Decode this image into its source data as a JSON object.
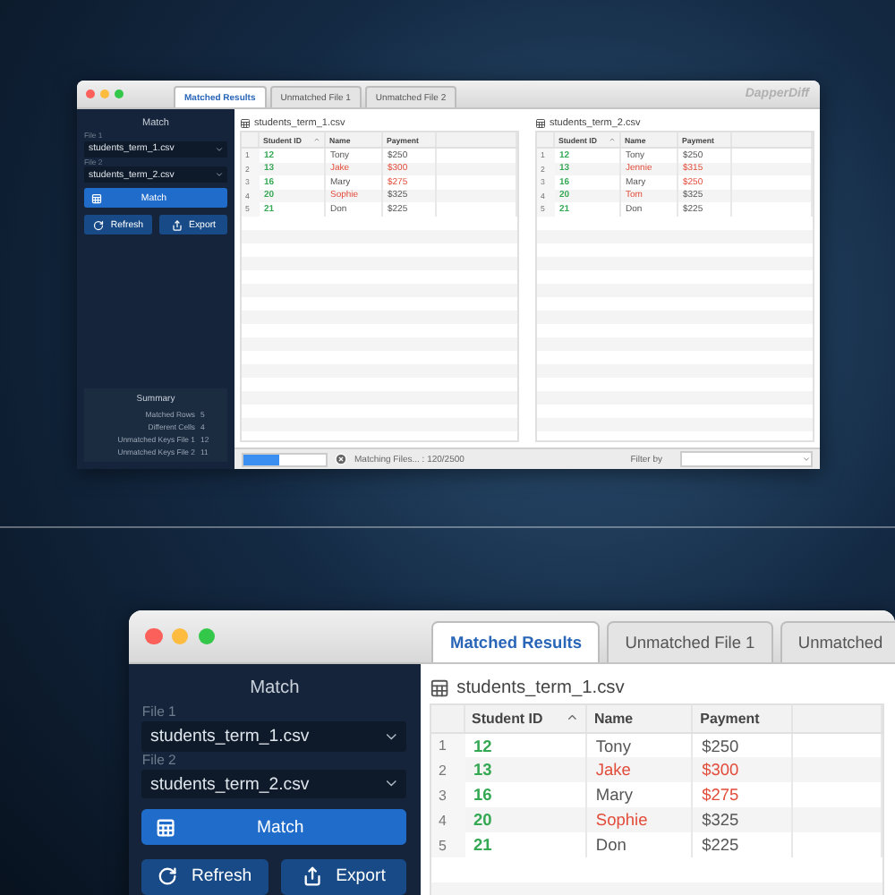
{
  "overview": {
    "window": {
      "app_name": "DapperDiff"
    },
    "tabs": [
      {
        "label": "Matched Results",
        "selected": true
      },
      {
        "label": "Unmatched File 1",
        "selected": false
      },
      {
        "label": "Unmatched File 2",
        "selected": false
      }
    ],
    "sidebar": {
      "title": "Match",
      "files": [
        {
          "label": "File 1",
          "value": "students_term_1.csv"
        },
        {
          "label": "File 2",
          "value": "students_term_2.csv"
        }
      ],
      "buttons": [
        {
          "kind": "match",
          "label": "Match"
        },
        {
          "kind": "refresh",
          "label": "Refresh"
        },
        {
          "kind": "export",
          "label": "Export"
        }
      ],
      "summary": {
        "title": "Summary",
        "rows": [
          {
            "label": "Matched Rows",
            "value": "5"
          },
          {
            "label": "Different Cells",
            "value": "4"
          },
          {
            "label": "Unmatched Keys File 1",
            "value": "12"
          },
          {
            "label": "Unmatched Keys File 2",
            "value": "11"
          }
        ]
      }
    },
    "panes": [
      {
        "file": "students_term_1.csv",
        "columns": [
          {
            "label": "Student ID",
            "sorted": true
          },
          {
            "label": "Name",
            "sorted": false
          },
          {
            "label": "Payment",
            "sorted": false
          }
        ],
        "rows": [
          {
            "number": "1",
            "cells": [
              {
                "text": "12",
                "key": true,
                "differs": false
              },
              {
                "text": "Tony",
                "key": false,
                "differs": false
              },
              {
                "text": "$250",
                "key": false,
                "differs": false
              }
            ]
          },
          {
            "number": "2",
            "cells": [
              {
                "text": "13",
                "key": true,
                "differs": false
              },
              {
                "text": "Jake",
                "key": false,
                "differs": true
              },
              {
                "text": "$300",
                "key": false,
                "differs": true
              }
            ]
          },
          {
            "number": "3",
            "cells": [
              {
                "text": "16",
                "key": true,
                "differs": false
              },
              {
                "text": "Mary",
                "key": false,
                "differs": false
              },
              {
                "text": "$275",
                "key": false,
                "differs": true
              }
            ]
          },
          {
            "number": "4",
            "cells": [
              {
                "text": "20",
                "key": true,
                "differs": false
              },
              {
                "text": "Sophie",
                "key": false,
                "differs": true
              },
              {
                "text": "$325",
                "key": false,
                "differs": false
              }
            ]
          },
          {
            "number": "5",
            "cells": [
              {
                "text": "21",
                "key": true,
                "differs": false
              },
              {
                "text": "Don",
                "key": false,
                "differs": false
              },
              {
                "text": "$225",
                "key": false,
                "differs": false
              }
            ]
          }
        ]
      },
      {
        "file": "students_term_2.csv",
        "columns": [
          {
            "label": "Student ID",
            "sorted": true
          },
          {
            "label": "Name",
            "sorted": false
          },
          {
            "label": "Payment",
            "sorted": false
          }
        ],
        "rows": [
          {
            "number": "1",
            "cells": [
              {
                "text": "12",
                "key": true,
                "differs": false
              },
              {
                "text": "Tony",
                "key": false,
                "differs": false
              },
              {
                "text": "$250",
                "key": false,
                "differs": false
              }
            ]
          },
          {
            "number": "2",
            "cells": [
              {
                "text": "13",
                "key": true,
                "differs": false
              },
              {
                "text": "Jennie",
                "key": false,
                "differs": true
              },
              {
                "text": "$315",
                "key": false,
                "differs": true
              }
            ]
          },
          {
            "number": "3",
            "cells": [
              {
                "text": "16",
                "key": true,
                "differs": false
              },
              {
                "text": "Mary",
                "key": false,
                "differs": false
              },
              {
                "text": "$250",
                "key": false,
                "differs": true
              }
            ]
          },
          {
            "number": "4",
            "cells": [
              {
                "text": "20",
                "key": true,
                "differs": false
              },
              {
                "text": "Tom",
                "key": false,
                "differs": true
              },
              {
                "text": "$325",
                "key": false,
                "differs": false
              }
            ]
          },
          {
            "number": "5",
            "cells": [
              {
                "text": "21",
                "key": true,
                "differs": false
              },
              {
                "text": "Don",
                "key": false,
                "differs": false
              },
              {
                "text": "$225",
                "key": false,
                "differs": false
              }
            ]
          }
        ]
      }
    ],
    "status_bar": {
      "progress": {
        "level": 0.43
      },
      "message": "Matching Files... : 120/2500",
      "filter_label": "Filter by"
    }
  },
  "detail": {
    "tabs": [
      {
        "label": "Matched Results",
        "selected": true
      },
      {
        "label": "Unmatched File 1",
        "selected": false
      },
      {
        "label": "Unmatched",
        "selected": false
      }
    ],
    "sidebar": {
      "title": "Match",
      "files": [
        {
          "label": "File 1",
          "value": "students_term_1.csv"
        },
        {
          "label": "File 2",
          "value": "students_term_2.csv"
        }
      ],
      "buttons": [
        {
          "kind": "match",
          "label": "Match"
        },
        {
          "kind": "refresh",
          "label": "Refresh"
        },
        {
          "kind": "export",
          "label": "Export"
        }
      ]
    },
    "panes": [
      {
        "file": "students_term_1.csv",
        "columns": [
          {
            "label": "Student ID",
            "sorted": true
          },
          {
            "label": "Name",
            "sorted": false
          },
          {
            "label": "Payment",
            "sorted": false
          }
        ],
        "rows": [
          {
            "number": "1",
            "cells": [
              {
                "text": "12",
                "key": true,
                "differs": false
              },
              {
                "text": "Tony",
                "key": false,
                "differs": false
              },
              {
                "text": "$250",
                "key": false,
                "differs": false
              }
            ]
          },
          {
            "number": "2",
            "cells": [
              {
                "text": "13",
                "key": true,
                "differs": false
              },
              {
                "text": "Jake",
                "key": false,
                "differs": true
              },
              {
                "text": "$300",
                "key": false,
                "differs": true
              }
            ]
          },
          {
            "number": "3",
            "cells": [
              {
                "text": "16",
                "key": true,
                "differs": false
              },
              {
                "text": "Mary",
                "key": false,
                "differs": false
              },
              {
                "text": "$275",
                "key": false,
                "differs": true
              }
            ]
          },
          {
            "number": "4",
            "cells": [
              {
                "text": "20",
                "key": true,
                "differs": false
              },
              {
                "text": "Sophie",
                "key": false,
                "differs": true
              },
              {
                "text": "$325",
                "key": false,
                "differs": false
              }
            ]
          },
          {
            "number": "5",
            "cells": [
              {
                "text": "21",
                "key": true,
                "differs": false
              },
              {
                "text": "Don",
                "key": false,
                "differs": false
              },
              {
                "text": "$225",
                "key": false,
                "differs": false
              }
            ]
          }
        ]
      }
    ]
  }
}
